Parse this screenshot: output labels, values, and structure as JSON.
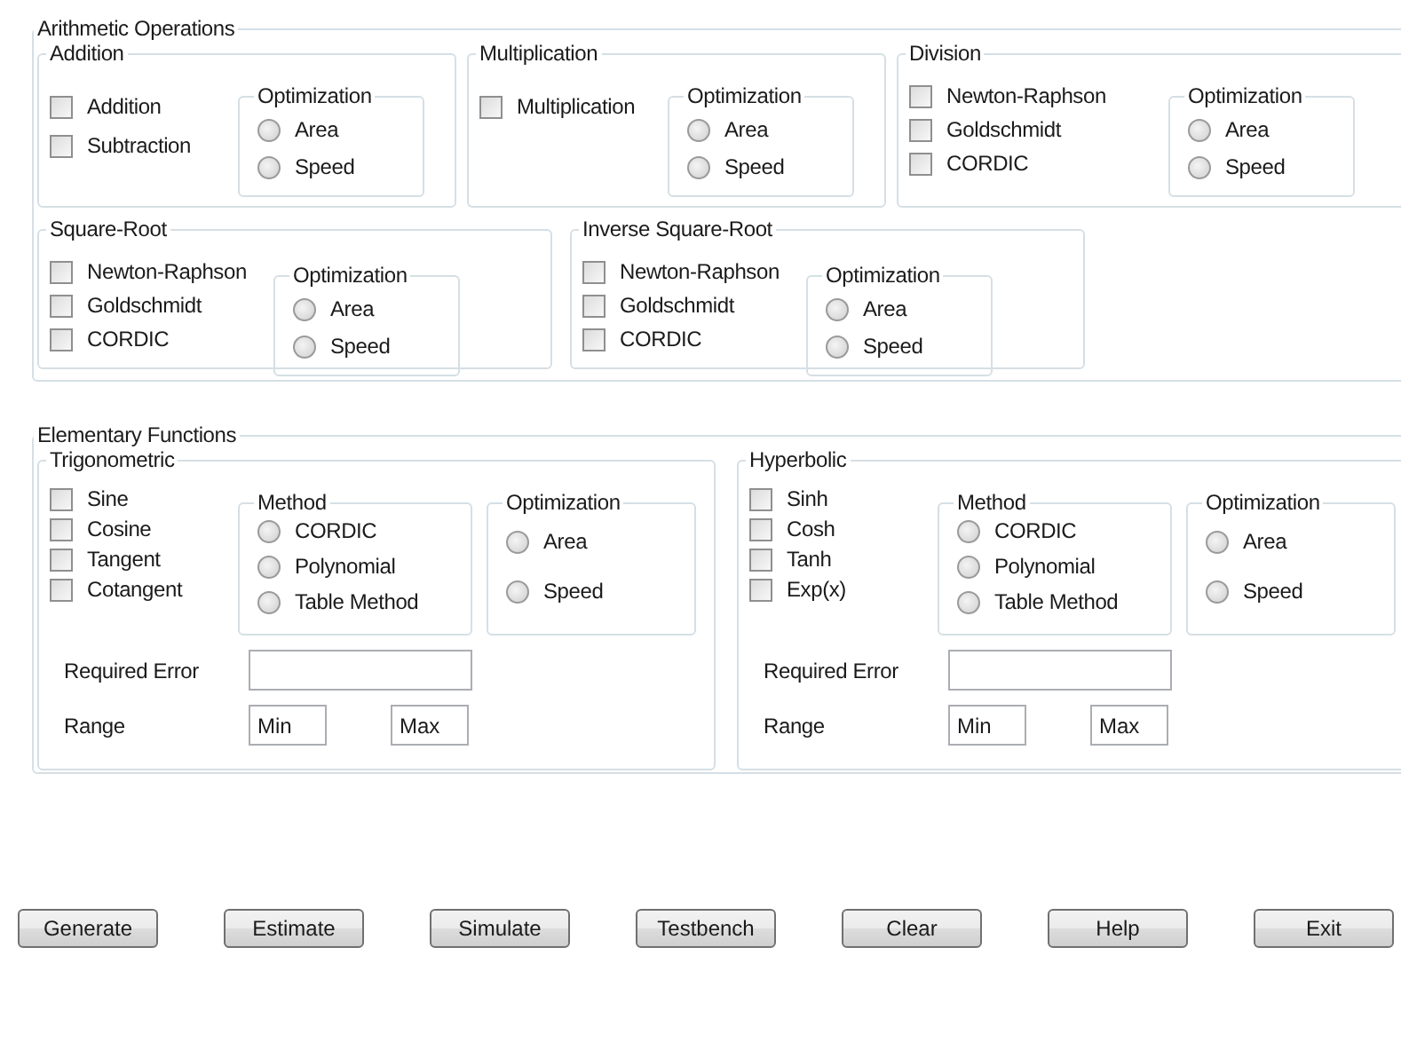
{
  "arithmetic": {
    "title": "Arithmetic Operations",
    "groups": [
      {
        "title": "Addition",
        "options": [
          {
            "label": "Addition",
            "checked": false
          },
          {
            "label": "Subtraction",
            "checked": false
          }
        ],
        "optimization": {
          "title": "Optimization",
          "choices": [
            {
              "label": "Area",
              "selected": false
            },
            {
              "label": "Speed",
              "selected": false
            }
          ]
        }
      },
      {
        "title": "Multiplication",
        "options": [
          {
            "label": "Multiplication",
            "checked": false
          }
        ],
        "optimization": {
          "title": "Optimization",
          "choices": [
            {
              "label": "Area",
              "selected": false
            },
            {
              "label": "Speed",
              "selected": false
            }
          ]
        }
      },
      {
        "title": "Division",
        "options": [
          {
            "label": "Newton-Raphson",
            "checked": false
          },
          {
            "label": "Goldschmidt",
            "checked": false
          },
          {
            "label": "CORDIC",
            "checked": false
          }
        ],
        "optimization": {
          "title": "Optimization",
          "choices": [
            {
              "label": "Area",
              "selected": false
            },
            {
              "label": "Speed",
              "selected": false
            }
          ]
        }
      },
      {
        "title": "Square-Root",
        "options": [
          {
            "label": "Newton-Raphson",
            "checked": false
          },
          {
            "label": "Goldschmidt",
            "checked": false
          },
          {
            "label": "CORDIC",
            "checked": false
          }
        ],
        "optimization": {
          "title": "Optimization",
          "choices": [
            {
              "label": "Area",
              "selected": false
            },
            {
              "label": "Speed",
              "selected": false
            }
          ]
        }
      },
      {
        "title": "Inverse Square-Root",
        "options": [
          {
            "label": "Newton-Raphson",
            "checked": false
          },
          {
            "label": "Goldschmidt",
            "checked": false
          },
          {
            "label": "CORDIC",
            "checked": false
          }
        ],
        "optimization": {
          "title": "Optimization",
          "choices": [
            {
              "label": "Area",
              "selected": false
            },
            {
              "label": "Speed",
              "selected": false
            }
          ]
        }
      }
    ]
  },
  "elementary": {
    "title": "Elementary Functions",
    "groups": [
      {
        "title": "Trigonometric",
        "options": [
          {
            "label": "Sine",
            "checked": false
          },
          {
            "label": "Cosine",
            "checked": false
          },
          {
            "label": "Tangent",
            "checked": false
          },
          {
            "label": "Cotangent",
            "checked": false
          }
        ],
        "method": {
          "title": "Method",
          "choices": [
            {
              "label": "CORDIC",
              "selected": false
            },
            {
              "label": "Polynomial",
              "selected": false
            },
            {
              "label": "Table Method",
              "selected": false
            }
          ]
        },
        "optimization": {
          "title": "Optimization",
          "choices": [
            {
              "label": "Area",
              "selected": false
            },
            {
              "label": "Speed",
              "selected": false
            }
          ]
        },
        "required_error": {
          "label": "Required Error"
        },
        "range": {
          "label": "Range",
          "min": {
            "value": "Min"
          },
          "max": {
            "value": "Max"
          }
        }
      },
      {
        "title": "Hyperbolic",
        "options": [
          {
            "label": "Sinh",
            "checked": false
          },
          {
            "label": "Cosh",
            "checked": false
          },
          {
            "label": "Tanh",
            "checked": false
          },
          {
            "label": "Exp(x)",
            "checked": false
          }
        ],
        "method": {
          "title": "Method",
          "choices": [
            {
              "label": "CORDIC",
              "selected": false
            },
            {
              "label": "Polynomial",
              "selected": false
            },
            {
              "label": "Table Method",
              "selected": false
            }
          ]
        },
        "optimization": {
          "title": "Optimization",
          "choices": [
            {
              "label": "Area",
              "selected": false
            },
            {
              "label": "Speed",
              "selected": false
            }
          ]
        },
        "required_error": {
          "label": "Required Error"
        },
        "range": {
          "label": "Range",
          "min": {
            "value": "Min"
          },
          "max": {
            "value": "Max"
          }
        }
      }
    ]
  },
  "buttons": [
    "Generate",
    "Estimate",
    "Simulate",
    "Testbench",
    "Clear",
    "Help",
    "Exit"
  ]
}
